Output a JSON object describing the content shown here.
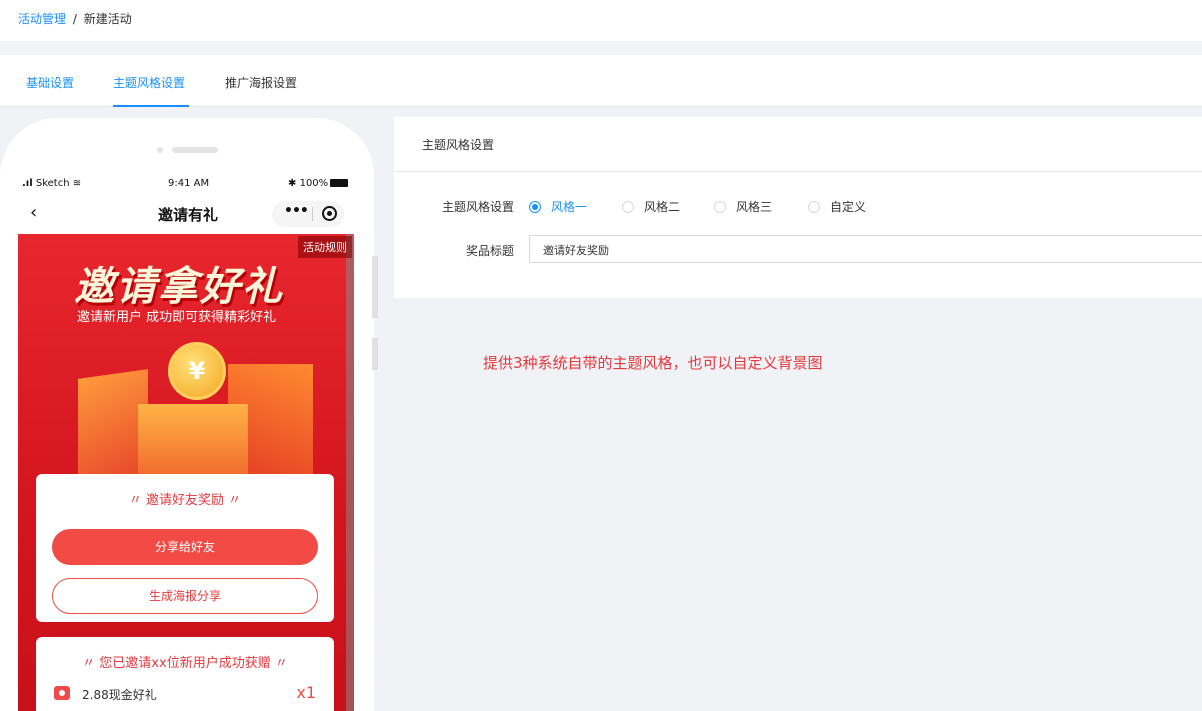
{
  "breadcrumb": {
    "parent": "活动管理",
    "separator": "/",
    "current": "新建活动"
  },
  "tabs": [
    {
      "label": "基础设置"
    },
    {
      "label": "主题风格设置"
    },
    {
      "label": "推广海报设置"
    }
  ],
  "phone": {
    "status": {
      "carrier": "Sketch",
      "time": "9:41 AM",
      "battery": "100%"
    },
    "nav": {
      "back": "‹",
      "title": "邀请有礼",
      "more": "•••"
    },
    "campaign": {
      "rules": "活动规则",
      "hero_title": "邀请拿好礼",
      "hero_sub": "邀请新用户 成功即可获得精彩好礼",
      "coin_symbol": "¥",
      "card1_title": "〃 邀请好友奖励 〃",
      "share_button": "分享给好友",
      "poster_button": "生成海报分享",
      "card2_title": "〃 您已邀请xx位新用户成功获赠 〃",
      "gift_name": "2.88现金好礼",
      "gift_count": "x1"
    }
  },
  "panel": {
    "title": "主题风格设置",
    "theme_label": "主题风格设置",
    "theme_options": [
      {
        "label": "风格一",
        "checked": true
      },
      {
        "label": "风格二",
        "checked": false
      },
      {
        "label": "风格三",
        "checked": false
      },
      {
        "label": "自定义",
        "checked": false
      }
    ],
    "prize_label": "奖品标题",
    "prize_value": "邀请好友奖励"
  },
  "note": "提供3种系统自带的主题风格，也可以自定义背景图",
  "colors": {
    "primary": "#1890ff",
    "accent_red": "#e8383d",
    "campaign_red": "#d4161e"
  }
}
